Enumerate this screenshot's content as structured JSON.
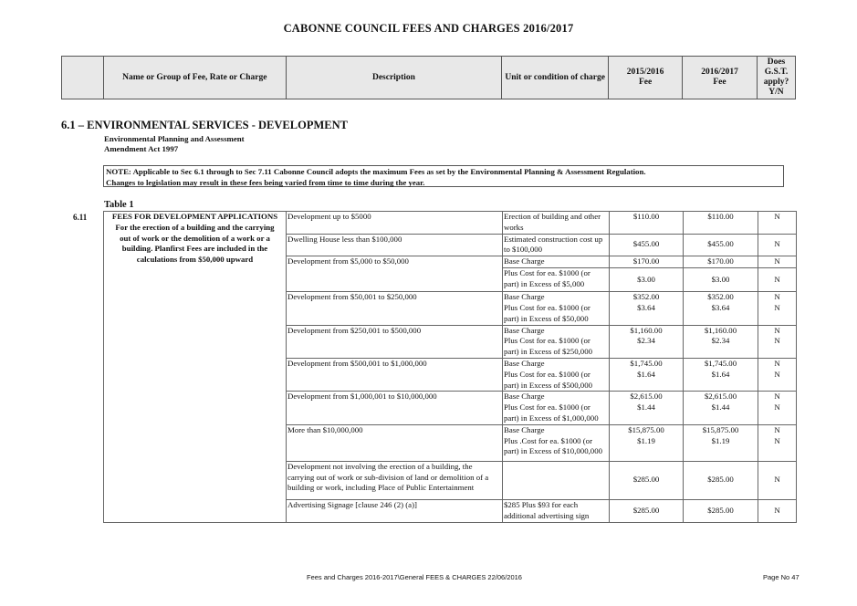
{
  "page_title": "CABONNE COUNCIL FEES AND CHARGES 2016/2017",
  "header": {
    "name": "Name or Group of Fee, Rate or Charge",
    "description": "Description",
    "unit": "Unit or condition of charge",
    "fee_prev": [
      "2015/2016",
      "Fee"
    ],
    "fee_curr": [
      "2016/2017",
      "Fee"
    ],
    "gst": [
      "Does",
      "G.S.T.",
      "apply?",
      "Y/N"
    ]
  },
  "section": {
    "title": "6.1 – ENVIRONMENTAL SERVICES - DEVELOPMENT",
    "sub1": "Environmental Planning and Assessment",
    "sub2": "Amendment Act 1997",
    "note_line1": "NOTE: Applicable to Sec 6.1 through to Sec 7.11 Cabonne Council adopts the maximum Fees as set by the Environmental Planning & Assessment Regulation.",
    "note_line2": "Changes to legislation may result in these fees being varied from time to time during the year.",
    "table_label": "Table 1",
    "number": "6.11"
  },
  "group": {
    "title": "FEES FOR DEVELOPMENT APPLICATIONS",
    "lines": [
      "For the erection of a building and the carrying",
      "out of work or the demolition of a work or a",
      "building. Planfirst Fees are included in the",
      "calculations from $50,000 upward"
    ]
  },
  "rows": {
    "r1": {
      "desc": "Development up to $5000",
      "unit": [
        "Erection of building and other",
        "works"
      ],
      "prev": "$110.00",
      "curr": "$110.00",
      "gst": "N"
    },
    "r2": {
      "desc": "Dwelling House less than $100,000",
      "unit": [
        "Estimated construction cost up",
        "to $100,000"
      ],
      "prev": "$455.00",
      "curr": "$455.00",
      "gst": "N"
    },
    "r3": {
      "desc": "Development from $5,000 to $50,000",
      "unit_a": "Base Charge",
      "unit_b": [
        "Plus Cost for ea. $1000 (or",
        "part) in Excess of $5,000"
      ],
      "prev_a": "$170.00",
      "curr_a": "$170.00",
      "gst_a": "N",
      "prev_b": "$3.00",
      "curr_b": "$3.00",
      "gst_b": "N"
    },
    "r4": {
      "desc": "Development from $50,001 to $250,000",
      "unit": [
        "Base Charge",
        "Plus Cost for ea. $1000 (or",
        "part) in Excess of $50,000"
      ],
      "prev": [
        "$352.00",
        "$3.64"
      ],
      "curr": [
        "$352.00",
        "$3.64"
      ],
      "gst": [
        "N",
        "N"
      ]
    },
    "r5": {
      "desc": "Development from $250,001 to $500,000",
      "unit": [
        "Base Charge",
        "Plus Cost for ea. $1000 (or",
        "part) in Excess of $250,000"
      ],
      "prev": [
        "$1,160.00",
        "$2.34"
      ],
      "curr": [
        "$1,160.00",
        "$2.34"
      ],
      "gst": [
        "N",
        "N"
      ]
    },
    "r6": {
      "desc": "Development from $500,001 to $1,000,000",
      "unit": [
        "Base Charge",
        "Plus Cost for ea. $1000 (or",
        "part) in Excess of $500,000"
      ],
      "prev": [
        "$1,745.00",
        "$1.64"
      ],
      "curr": [
        "$1,745.00",
        "$1.64"
      ],
      "gst": [
        "N",
        "N"
      ]
    },
    "r7": {
      "desc": "Development from $1,000,001 to $10,000,000",
      "unit": [
        "Base Charge",
        "Plus Cost for ea. $1000 (or",
        "part) in Excess of $1,000,000"
      ],
      "prev": [
        "$2,615.00",
        "$1.44"
      ],
      "curr": [
        "$2,615.00",
        "$1.44"
      ],
      "gst": [
        "N",
        "N"
      ]
    },
    "r8": {
      "desc": "More than $10,000,000",
      "unit": [
        "Base Charge",
        "Plus .Cost for ea. $1000 (or",
        "part) in Excess of $10,000,000"
      ],
      "prev": [
        "$15,875.00",
        "$1.19"
      ],
      "curr": [
        "$15,875.00",
        "$1.19"
      ],
      "gst": [
        "N",
        "N"
      ]
    },
    "r9": {
      "desc": [
        "Development not involving the erection of a building, the",
        "carrying out of work or sub-division of land or demolition of a",
        "building or work, including Place of Public Entertainment"
      ],
      "unit": "",
      "prev": "$285.00",
      "curr": "$285.00",
      "gst": "N"
    },
    "r10": {
      "desc": "Advertising Signage [clause 246 (2) (a)]",
      "unit": [
        "$285  Plus $93 for each",
        "additional  advertising sign"
      ],
      "prev": "$285.00",
      "curr": "$285.00",
      "gst": "N"
    }
  },
  "footer": {
    "left": "Fees and Charges 2016-2017\\General FEES & CHARGES 22/06/2016",
    "right": "Page No 47"
  }
}
